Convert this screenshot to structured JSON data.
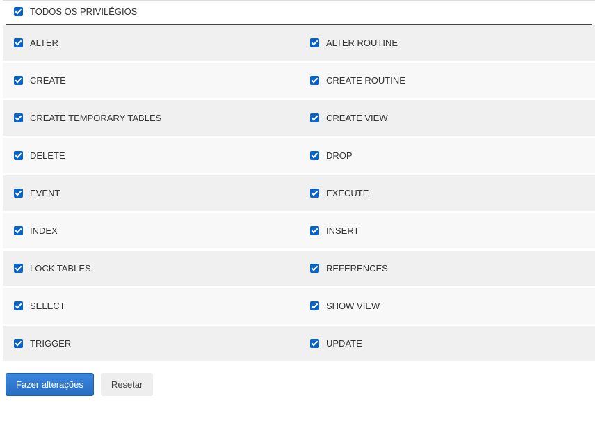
{
  "header": {
    "all_privileges_label": "TODOS OS PRIVILÉGIOS",
    "all_privileges_checked": true
  },
  "privileges": [
    {
      "left": {
        "label": "ALTER",
        "checked": true
      },
      "right": {
        "label": "ALTER ROUTINE",
        "checked": true
      }
    },
    {
      "left": {
        "label": "CREATE",
        "checked": true
      },
      "right": {
        "label": "CREATE ROUTINE",
        "checked": true
      }
    },
    {
      "left": {
        "label": "CREATE TEMPORARY TABLES",
        "checked": true
      },
      "right": {
        "label": "CREATE VIEW",
        "checked": true
      }
    },
    {
      "left": {
        "label": "DELETE",
        "checked": true
      },
      "right": {
        "label": "DROP",
        "checked": true
      }
    },
    {
      "left": {
        "label": "EVENT",
        "checked": true
      },
      "right": {
        "label": "EXECUTE",
        "checked": true
      }
    },
    {
      "left": {
        "label": "INDEX",
        "checked": true
      },
      "right": {
        "label": "INSERT",
        "checked": true
      }
    },
    {
      "left": {
        "label": "LOCK TABLES",
        "checked": true
      },
      "right": {
        "label": "REFERENCES",
        "checked": true
      }
    },
    {
      "left": {
        "label": "SELECT",
        "checked": true
      },
      "right": {
        "label": "SHOW VIEW",
        "checked": true
      }
    },
    {
      "left": {
        "label": "TRIGGER",
        "checked": true
      },
      "right": {
        "label": "UPDATE",
        "checked": true
      }
    }
  ],
  "actions": {
    "submit_label": "Fazer alterações",
    "reset_label": "Resetar"
  }
}
